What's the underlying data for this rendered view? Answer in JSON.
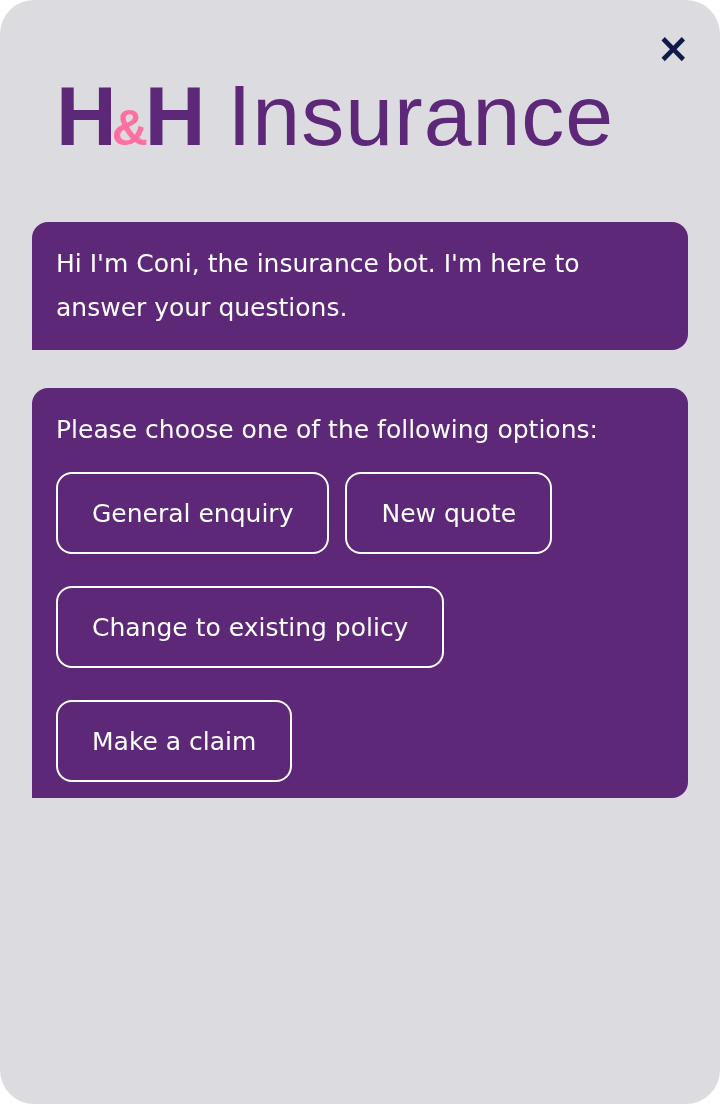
{
  "header": {
    "logo": {
      "initials": [
        "H",
        "&",
        "H"
      ],
      "name": "Insurance"
    },
    "close": "×"
  },
  "messages": [
    {
      "kind": "text",
      "text": "Hi I'm Coni, the insurance bot. I'm here to answer your questions."
    },
    {
      "kind": "options",
      "text": "Please choose one of the following options:",
      "options": [
        "General enquiry",
        "New quote",
        "Change to existing policy",
        "Make a claim"
      ]
    }
  ]
}
